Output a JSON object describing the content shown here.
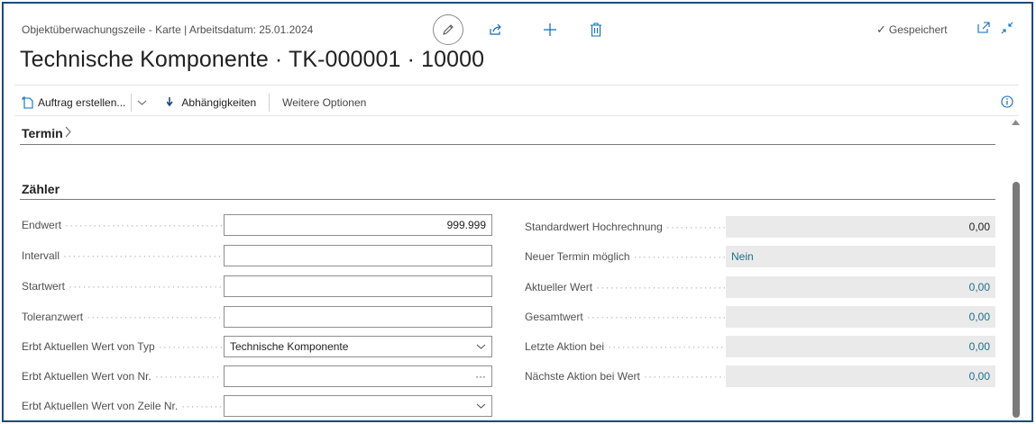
{
  "header": {
    "breadcrumb": "Objektüberwachungszeile - Karte | Arbeitsdatum: 25.01.2024",
    "title": "Technische Komponente · TK-000001 · 10000",
    "saved_label": "Gespeichert"
  },
  "icons": {
    "edit": "pencil-icon",
    "share": "share-icon",
    "new": "plus-icon",
    "delete": "trash-icon",
    "open_new_window": "open-in-new-window-icon",
    "collapse": "collapse-icon",
    "info": "info-icon"
  },
  "actionbar": {
    "create_order": "Auftrag erstellen...",
    "dependencies": "Abhängigkeiten",
    "more_options": "Weitere Optionen"
  },
  "sections": {
    "termin": "Termin",
    "zaehler": "Zähler"
  },
  "left_fields": [
    {
      "label": "Endwert",
      "value": "999.999",
      "type": "text"
    },
    {
      "label": "Intervall",
      "value": "",
      "type": "text"
    },
    {
      "label": "Startwert",
      "value": "",
      "type": "text"
    },
    {
      "label": "Toleranzwert",
      "value": "",
      "type": "text"
    },
    {
      "label": "Erbt Aktuellen Wert von Typ",
      "value": "Technische Komponente",
      "type": "select"
    },
    {
      "label": "Erbt Aktuellen Wert von Nr.",
      "value": "",
      "type": "lookup",
      "lookup_glyph": "···"
    },
    {
      "label": "Erbt Aktuellen Wert von Zeile Nr.",
      "value": "",
      "type": "select"
    }
  ],
  "right_fields": [
    {
      "label": "Standardwert Hochrechnung",
      "value": "0,00"
    },
    {
      "label": "Neuer Termin möglich",
      "value": "Nein"
    },
    {
      "label": "Aktueller Wert",
      "value": "0,00"
    },
    {
      "label": "Gesamtwert",
      "value": "0,00"
    },
    {
      "label": "Letzte Aktion bei",
      "value": "0,00"
    },
    {
      "label": "Nächste Aktion bei Wert",
      "value": "0,00"
    }
  ],
  "colors": {
    "accent": "#0f6cbd",
    "link_value": "#1b6e8a",
    "frame_border": "#1e4a78",
    "readonly_bg": "#eaeaea"
  }
}
